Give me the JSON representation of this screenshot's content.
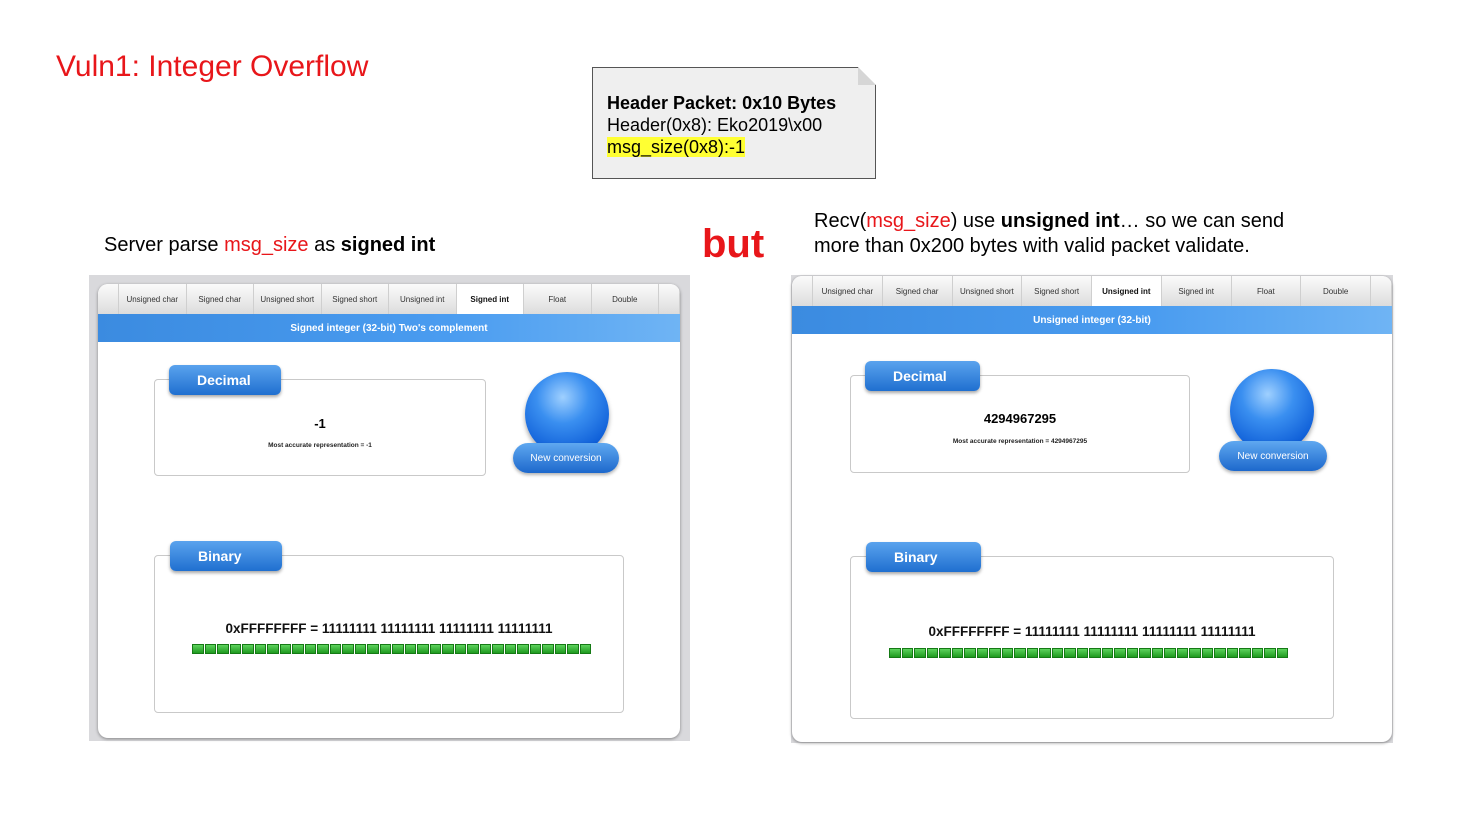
{
  "slide": {
    "title": "Vuln1: Integer Overflow",
    "note": {
      "heading": "Header Packet: 0x10 Bytes",
      "line1": "Header(0x8): Eko2019\\x00",
      "line2": "msg_size(0x8):-1"
    },
    "left_caption": {
      "p1": "Server parse ",
      "p2": "msg_size",
      "p3": " as ",
      "p4": "signed int"
    },
    "but": "but",
    "right_caption": {
      "p1": "Recv(",
      "p2": "msg_size",
      "p3": ") use ",
      "p4": "unsigned int",
      "p5": "… so we can send",
      "line2": "more than 0x200 bytes with valid packet validate."
    },
    "accent_color": "#e8161a",
    "highlight_color": "#ffff33"
  },
  "converter_left": {
    "tabs": [
      "Unsigned char",
      "Signed char",
      "Unsigned short",
      "Signed short",
      "Unsigned int",
      "Signed int",
      "Float",
      "Double"
    ],
    "active_tab": "Signed int",
    "header": "Signed integer (32-bit) Two's complement",
    "decimal_label": "Decimal",
    "decimal_value": "-1",
    "accurate": "Most accurate representation = -1",
    "new_conversion": "New conversion",
    "binary_label": "Binary",
    "binary_text": "0xFFFFFFFF = 11111111 11111111 11111111 11111111",
    "bit_count": 32
  },
  "converter_right": {
    "tabs": [
      "Unsigned char",
      "Signed char",
      "Unsigned short",
      "Signed short",
      "Unsigned int",
      "Signed int",
      "Float",
      "Double"
    ],
    "active_tab": "Unsigned int",
    "header": "Unsigned integer (32-bit)",
    "decimal_label": "Decimal",
    "decimal_value": "4294967295",
    "accurate": "Most accurate representation = 4294967295",
    "new_conversion": "New conversion",
    "binary_label": "Binary",
    "binary_text": "0xFFFFFFFF = 11111111 11111111 11111111 11111111",
    "bit_count": 32
  }
}
